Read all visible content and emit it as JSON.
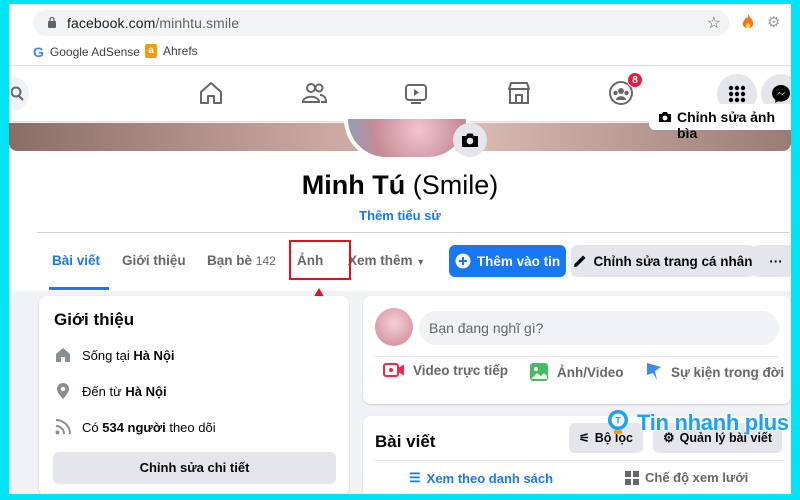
{
  "browser": {
    "url_host": "facebook.com",
    "url_path": "/minhtu.smile",
    "bookmarks": [
      {
        "label": "Google AdSense",
        "icon": "google-icon"
      },
      {
        "label": "Ahrefs",
        "icon": "ahrefs-icon"
      }
    ]
  },
  "nav": {
    "groups_badge": "8"
  },
  "profile": {
    "edit_cover_label": "Chỉnh sửa ảnh bìa",
    "name": "Minh Tú",
    "nickname": "(Smile)",
    "add_bio_label": "Thêm tiểu sử"
  },
  "tabs": {
    "posts": "Bài viết",
    "about": "Giới thiệu",
    "friends": "Bạn bè",
    "friends_count": "142",
    "photos": "Ảnh",
    "more": "Xem thêm"
  },
  "actions": {
    "add_story": "Thêm vào tin",
    "edit_profile": "Chỉnh sửa trang cá nhân",
    "more": "···"
  },
  "intro": {
    "title": "Giới thiệu",
    "lives_prefix": "Sống tại",
    "lives_place": "Hà Nội",
    "from_prefix": "Đến từ",
    "from_place": "Hà Nội",
    "followers_prefix": "Có",
    "followers_count": "534 người",
    "followers_suffix": "theo dõi",
    "edit_details": "Chỉnh sửa chi tiết"
  },
  "composer": {
    "placeholder": "Bạn đang nghĩ gì?",
    "live_video": "Video trực tiếp",
    "photo_video": "Ảnh/Video",
    "life_event": "Sự kiện trong đời"
  },
  "posts": {
    "title": "Bài viết",
    "filter": "Bộ lọc",
    "manage": "Quản lý bài viết",
    "list_view": "Xem theo danh sách",
    "grid_view": "Chế độ xem lưới"
  },
  "watermark": "Tin nhanh plus",
  "colors": {
    "fb_blue": "#1877f2",
    "highlight_red": "#e3101b",
    "frame_cyan": "#00e5f5"
  }
}
